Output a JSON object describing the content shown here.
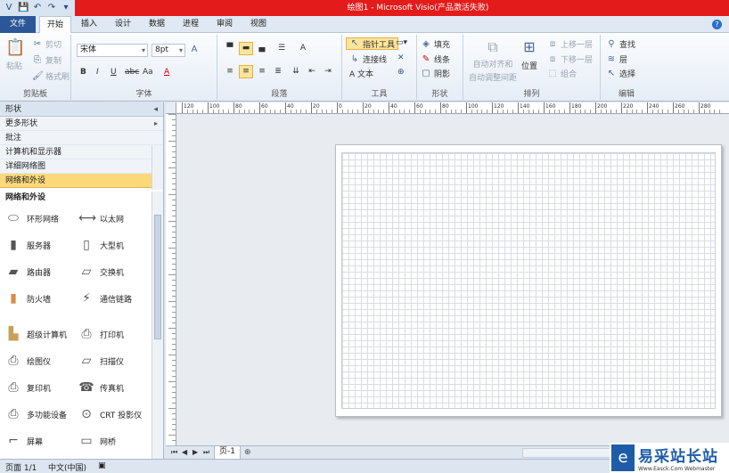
{
  "title": "绘图1 - Microsoft Visio(产品激活失败)",
  "quick_access": [
    "V",
    "💾",
    "↶",
    "↷",
    "▾"
  ],
  "tabs": {
    "file": "文件",
    "items": [
      "开始",
      "插入",
      "设计",
      "数据",
      "进程",
      "审阅",
      "视图"
    ],
    "active": "开始"
  },
  "ribbon": {
    "clipboard": {
      "label": "剪贴板",
      "paste": "粘贴",
      "cut": "剪切",
      "copy": "复制",
      "format_painter": "格式刷"
    },
    "font": {
      "label": "字体",
      "font_name": "宋体",
      "font_size": "8pt",
      "buttons": [
        "B",
        "I",
        "U",
        "abc",
        "Aa",
        "A"
      ]
    },
    "paragraph": {
      "label": "段落"
    },
    "tools": {
      "label": "工具",
      "pointer": "指针工具",
      "connector": "连接线",
      "text": "A 文本"
    },
    "shape": {
      "label": "形状",
      "fill": "填充",
      "line": "线条",
      "shadow": "阴影"
    },
    "arrange": {
      "label": "排列",
      "auto_align": "自动对齐和",
      "auto_align2": "自动调整间距",
      "position": "位置",
      "bring_forward": "上移一层",
      "send_backward": "下移一层",
      "group": "组合"
    },
    "edit": {
      "label": "编辑",
      "find": "查找",
      "layers": "层",
      "select": "选择"
    }
  },
  "shapes_panel": {
    "header": "形状",
    "stencils": [
      "更多形状",
      "批注",
      "计算机和显示器",
      "详细网络图",
      "网络和外设"
    ],
    "selected_stencil": "网络和外设",
    "section_title": "网络和外设",
    "shapes": [
      "环形网络",
      "以太网",
      "服务器",
      "大型机",
      "路由器",
      "交换机",
      "防火墙",
      "通信链路",
      "超级计算机",
      "打印机",
      "绘图仪",
      "扫描仪",
      "复印机",
      "传真机",
      "多功能设备",
      "CRT 投影仪",
      "屏幕",
      "网桥"
    ]
  },
  "ruler_labels": [
    "120",
    "100",
    "80",
    "60",
    "40",
    "20",
    "0",
    "20",
    "40",
    "60",
    "80",
    "100",
    "120",
    "140",
    "160",
    "180",
    "200",
    "220",
    "240",
    "260",
    "280"
  ],
  "page_tab": "页-1",
  "status": {
    "page": "页面 1/1",
    "language": "中文(中国)"
  },
  "logo": {
    "text": "易采站长站",
    "sub": "Www.Easck.Com  Webmaster"
  }
}
